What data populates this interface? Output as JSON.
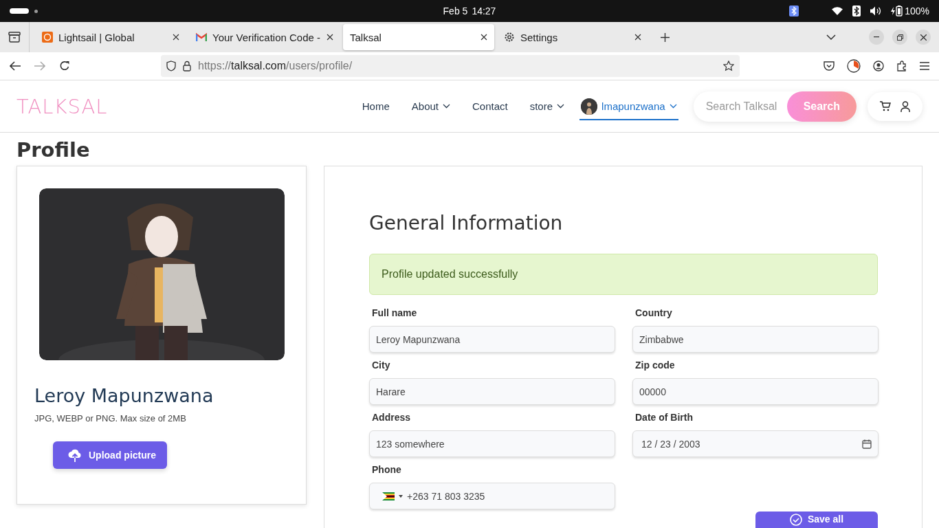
{
  "system_bar": {
    "date": "Feb 5",
    "time": "14:27",
    "battery": "100%"
  },
  "browser": {
    "tabs": [
      {
        "title": "Lightsail | Global",
        "selected": false
      },
      {
        "title": "Your Verification Code -",
        "selected": false
      },
      {
        "title": "Talksal",
        "selected": true
      },
      {
        "title": "Settings",
        "selected": false
      }
    ],
    "url": {
      "scheme": "https://",
      "host": "talksal.com",
      "path": "/users/profile/"
    }
  },
  "site": {
    "logo": "TALKSAL",
    "nav": [
      {
        "label": "Home",
        "dropdown": false,
        "selected": false,
        "avatar": false
      },
      {
        "label": "About",
        "dropdown": true,
        "selected": false,
        "avatar": false
      },
      {
        "label": "Contact",
        "dropdown": false,
        "selected": false,
        "avatar": false
      },
      {
        "label": "store",
        "dropdown": true,
        "selected": false,
        "avatar": false
      },
      {
        "label": "lmapunzwana",
        "dropdown": true,
        "selected": true,
        "avatar": true
      }
    ],
    "search": {
      "placeholder": "Search Talksal",
      "button": "Search"
    }
  },
  "page_title": "Profile",
  "profile_card": {
    "name": "Leroy Mapunzwana",
    "hint": "JPG, WEBP or PNG. Max size of 2MB",
    "upload_button": "Upload picture"
  },
  "form": {
    "heading": "General Information",
    "alert": "Profile updated successfully",
    "fields": [
      {
        "label": "Full name",
        "value": "Leroy Mapunzwana",
        "kind": "text"
      },
      {
        "label": "Country",
        "value": "Zimbabwe",
        "kind": "text"
      },
      {
        "label": "City",
        "value": "Harare",
        "kind": "text"
      },
      {
        "label": "Zip code",
        "value": "00000",
        "kind": "text"
      },
      {
        "label": "Address",
        "value": "123 somewhere",
        "kind": "text"
      },
      {
        "label": "Date of Birth",
        "value": "12 / 23 / 2003",
        "kind": "date"
      },
      {
        "label": "Phone",
        "value": "+263 71 803 3235",
        "kind": "phone"
      }
    ],
    "save_button": "Save all"
  }
}
